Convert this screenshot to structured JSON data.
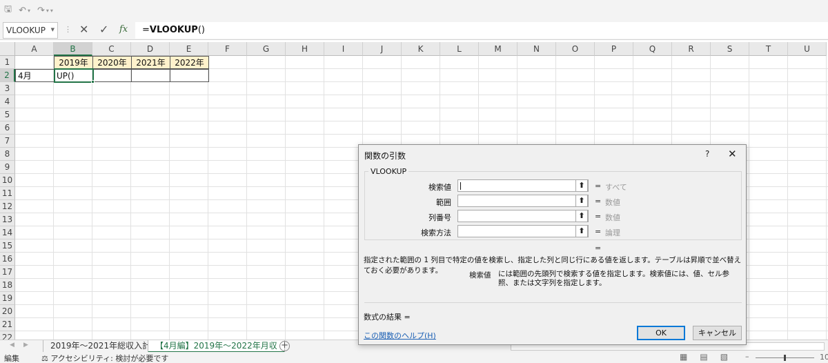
{
  "quick_access": {
    "save_icon": "save-icon",
    "undo_icon": "undo-icon",
    "redo_icon": "redo-icon",
    "customize_icon": "customize-qat-icon"
  },
  "formula_bar": {
    "name_box": "VLOOKUP",
    "formula_prefix": "=",
    "formula_function": "VLOOKUP",
    "formula_suffix": "()",
    "fx_symbol": "fx"
  },
  "grid": {
    "columns": [
      "A",
      "B",
      "C",
      "D",
      "E",
      "F",
      "G",
      "H",
      "I",
      "J",
      "K",
      "L",
      "M",
      "N",
      "O",
      "P",
      "Q",
      "R",
      "S",
      "T",
      "U"
    ],
    "rows": [
      "1",
      "2",
      "3",
      "4",
      "5",
      "6",
      "7",
      "8",
      "9",
      "10",
      "11",
      "12",
      "13",
      "14",
      "15",
      "16",
      "17",
      "18",
      "19",
      "20",
      "21",
      "22"
    ],
    "active_cell": "B2",
    "cells": {
      "B1": "2019年",
      "C1": "2020年",
      "D1": "2021年",
      "E1": "2022年",
      "A2": "4月",
      "B2": "UP()"
    }
  },
  "sheet_tabs": [
    {
      "label": "2019年～2021年総収入計",
      "active": false
    },
    {
      "label": "【4月編】2019年～2022年月収",
      "active": true
    }
  ],
  "status_bar": {
    "mode": "編集",
    "accessibility": "アクセシビリティ: 検討が必要です",
    "zoom": "10"
  },
  "dialog": {
    "title": "関数の引数",
    "help_glyph": "?",
    "close_glyph": "✕",
    "function_name": "VLOOKUP",
    "args": [
      {
        "label": "検索値",
        "value": "",
        "type": "すべて"
      },
      {
        "label": "範囲",
        "value": "",
        "type": "数値"
      },
      {
        "label": "列番号",
        "value": "",
        "type": "数値"
      },
      {
        "label": "検索方法",
        "value": "",
        "type": "論理"
      }
    ],
    "equals": "=",
    "result_equals": "=",
    "description": "指定された範囲の 1 列目で特定の値を検索し、指定した列と同じ行にある値を返します。テーブルは昇順で並べ替えておく必要があります。",
    "arg_name": "検索値",
    "arg_description": "には範囲の先頭列で検索する値を指定します。検索値には、値、セル参照、または文字列を指定します。",
    "formula_result": "数式の結果 =",
    "help_link": "この関数のヘルプ(H)",
    "ok": "OK",
    "cancel": "キャンセル"
  }
}
